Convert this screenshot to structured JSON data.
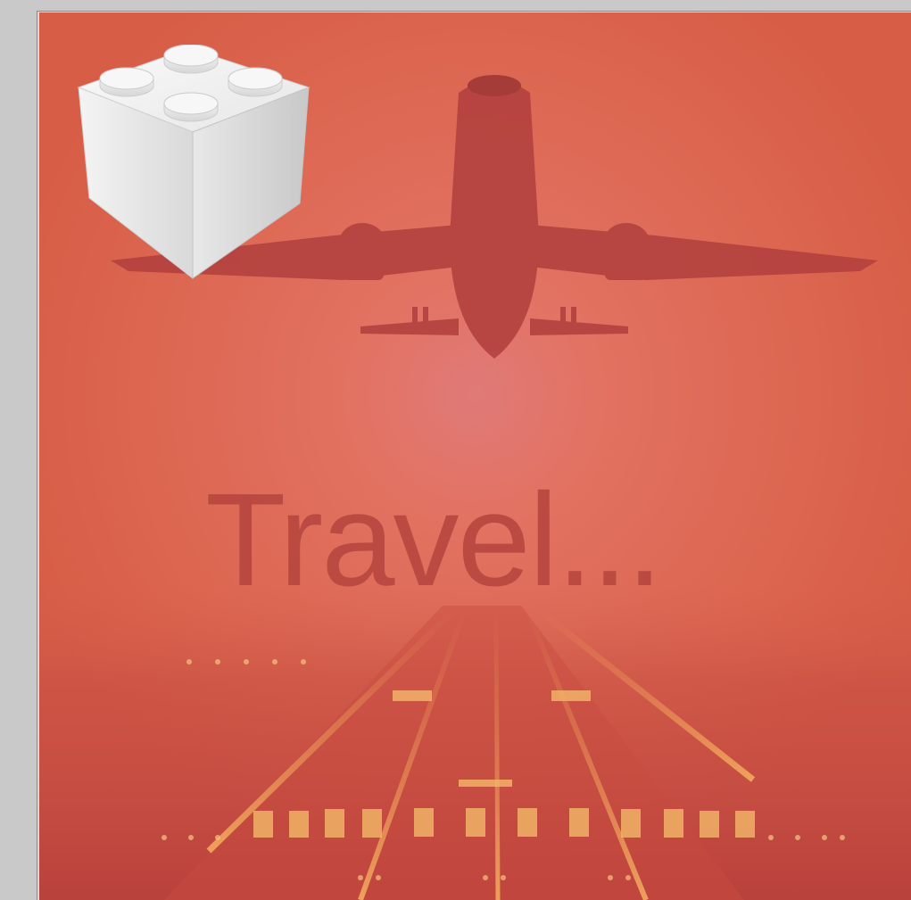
{
  "poster": {
    "title": "Travel...",
    "background_color": "#de6a52",
    "accent_color": "#b84840",
    "subject_icon": "airplane-icon",
    "scene_icon": "runway-lights"
  },
  "overlay": {
    "icon": "plugin-bundle-icon"
  }
}
